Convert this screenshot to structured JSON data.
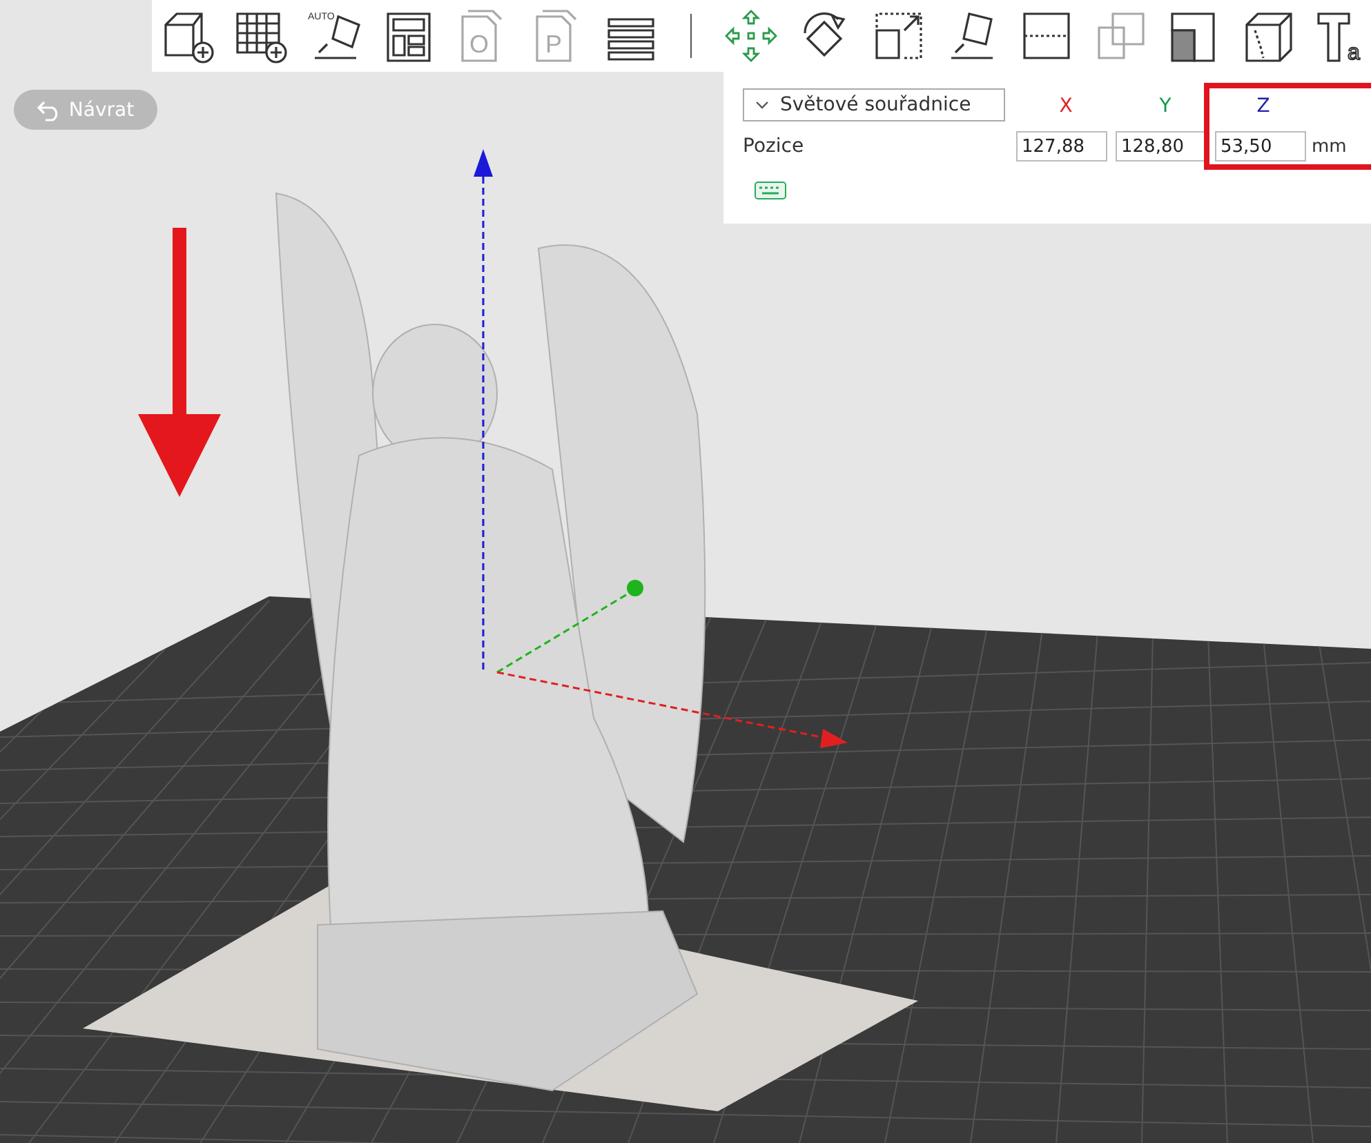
{
  "back_button": {
    "label": "Návrat"
  },
  "toolbar": {
    "tools": [
      {
        "kind": "add-cube",
        "disabled": false
      },
      {
        "kind": "add-plate",
        "disabled": false
      },
      {
        "kind": "auto-orient",
        "label": "AUTO",
        "disabled": false
      },
      {
        "kind": "arrange",
        "disabled": false
      },
      {
        "kind": "plate-letter",
        "label": "O",
        "disabled": true
      },
      {
        "kind": "plate-letter",
        "label": "P",
        "disabled": true
      },
      {
        "kind": "layers",
        "disabled": false
      },
      {
        "kind": "separator"
      },
      {
        "kind": "move",
        "disabled": false
      },
      {
        "kind": "rotate",
        "disabled": false
      },
      {
        "kind": "scale",
        "disabled": false
      },
      {
        "kind": "lay-on-face",
        "disabled": false
      },
      {
        "kind": "cut",
        "disabled": false
      },
      {
        "kind": "boolean",
        "disabled": true
      },
      {
        "kind": "support-paint",
        "disabled": false
      },
      {
        "kind": "seam",
        "disabled": false
      },
      {
        "kind": "text",
        "label": "a",
        "disabled": false
      }
    ]
  },
  "panel": {
    "coordinate_system": "Světové souřadnice",
    "axes": [
      {
        "label": "X",
        "color": "#e02020",
        "highlighted": false
      },
      {
        "label": "Y",
        "color": "#119944",
        "highlighted": false
      },
      {
        "label": "Z",
        "color": "#2222aa",
        "highlighted": true
      }
    ],
    "rows": [
      {
        "label": "Pozice",
        "values": [
          "127,88",
          "128,80",
          "53,50"
        ],
        "unit": "mm"
      }
    ]
  }
}
